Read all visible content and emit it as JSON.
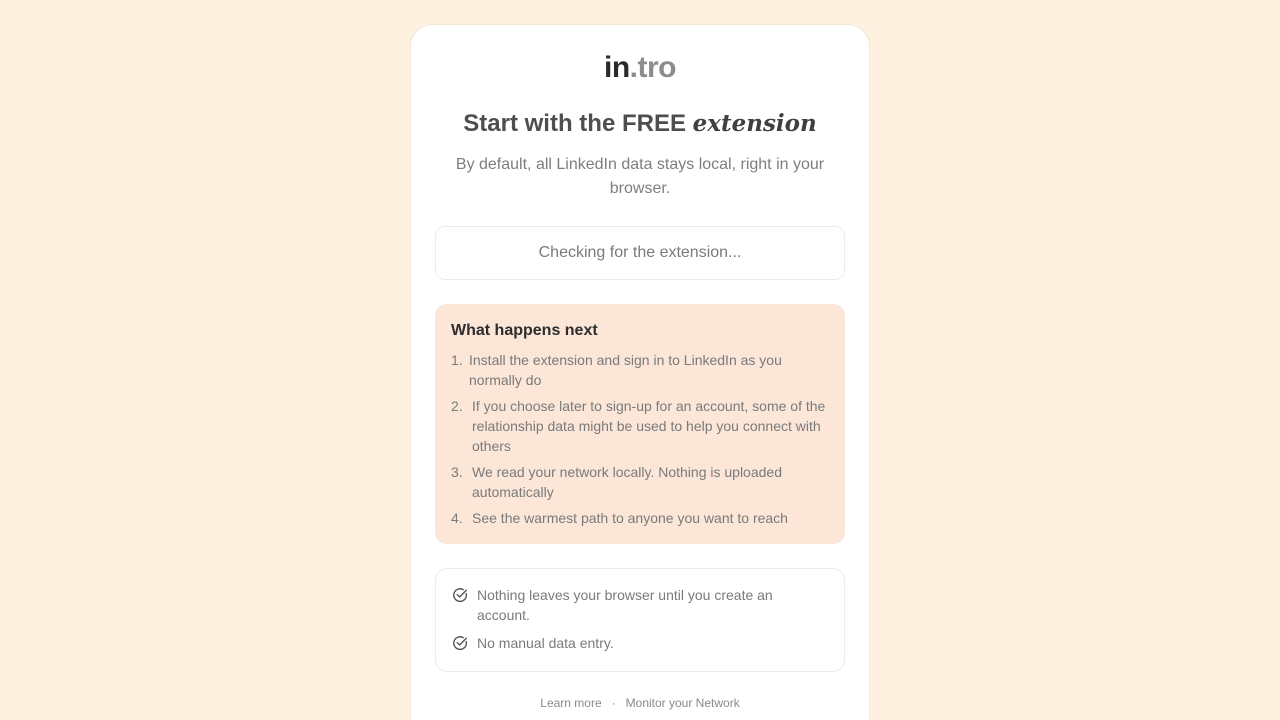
{
  "logo": {
    "part1": "in",
    "part2": ".tro"
  },
  "headline": {
    "main": "Start with the FREE ",
    "accent": "extension"
  },
  "subtitle": "By default, all LinkedIn data stays local, right in your browser.",
  "status": "Checking for the extension...",
  "next_steps": {
    "title": "What happens next",
    "items": [
      {
        "num": "1.",
        "text": "Install the extension and sign in to LinkedIn as you normally do"
      },
      {
        "num": "2.",
        "text": "If you choose later to sign-up for an account, some of the relationship data might be used to help you connect with others"
      },
      {
        "num": "3.",
        "text": "We read your network locally. Nothing is uploaded automatically"
      },
      {
        "num": "4.",
        "text": "See the warmest path to anyone you want to reach"
      }
    ]
  },
  "assurances": {
    "icon": "check-circle-icon",
    "items": [
      {
        "text": "Nothing leaves your browser until you create an account."
      },
      {
        "text": "No manual data entry."
      }
    ]
  },
  "footer": {
    "learn_more": "Learn more",
    "separator": "·",
    "monitor": "Monitor your Network"
  },
  "colors": {
    "background": "#fff1e0",
    "steps_panel": "#fbe6d8",
    "card": "#ffffff"
  }
}
